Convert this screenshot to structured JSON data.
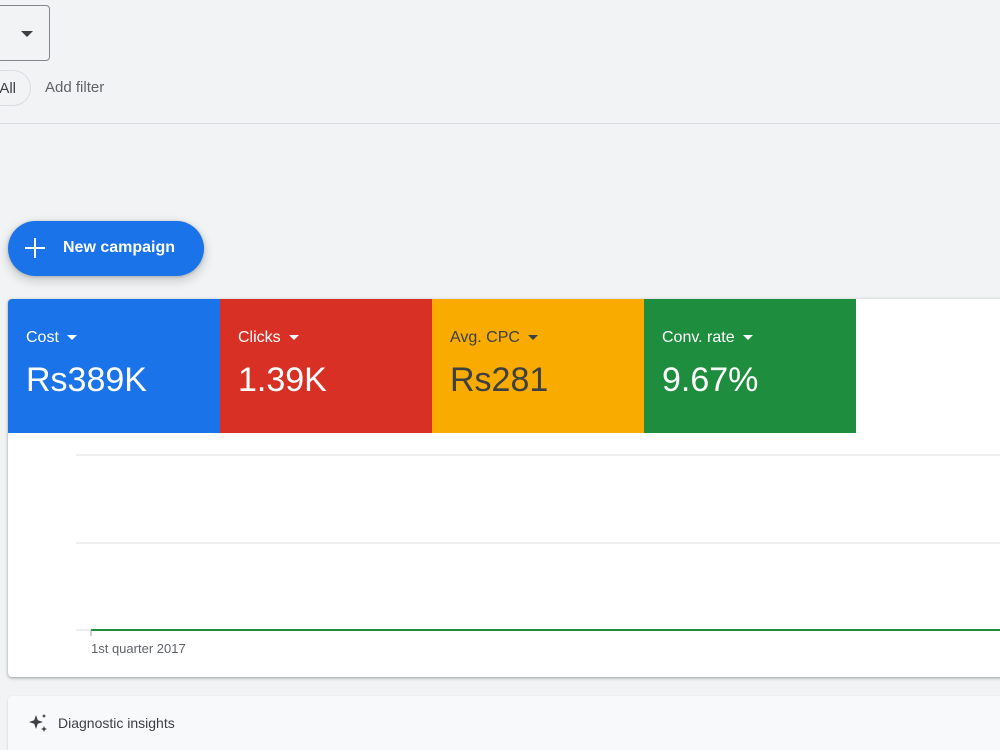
{
  "filters": {
    "all_chip": "All",
    "add_filter": "Add filter"
  },
  "fab": {
    "label": "New campaign"
  },
  "metrics": [
    {
      "label": "Cost",
      "value": "Rs389K",
      "color": "#1a73e8",
      "text_color": "#ffffff"
    },
    {
      "label": "Clicks",
      "value": "1.39K",
      "color": "#d93025",
      "text_color": "#ffffff"
    },
    {
      "label": "Avg. CPC",
      "value": "Rs281",
      "color": "#f9ab00",
      "text_color": "#3c4043"
    },
    {
      "label": "Conv. rate",
      "value": "9.67%",
      "color": "#1e8e3e",
      "text_color": "#ffffff"
    }
  ],
  "chart": {
    "x_tick": "1st quarter 2017",
    "series_color": "#1e8e3e"
  },
  "insights": {
    "label": "Diagnostic insights"
  }
}
